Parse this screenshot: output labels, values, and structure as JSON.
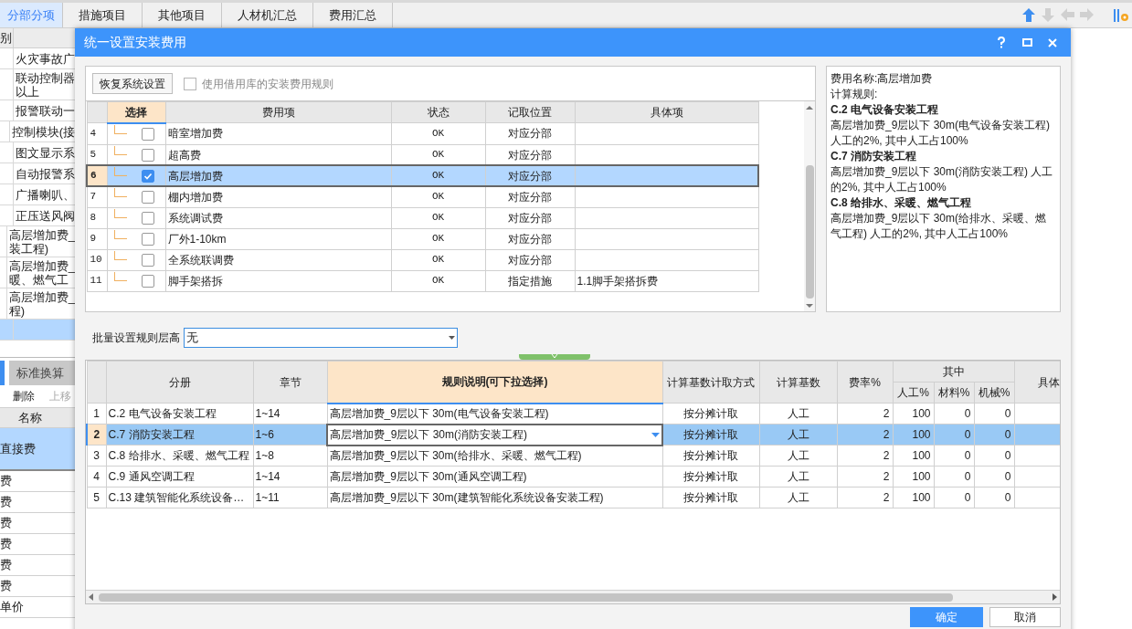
{
  "app_tabs": [
    {
      "label": "分部分项",
      "selected": true
    },
    {
      "label": "措施项目",
      "selected": false
    },
    {
      "label": "其他项目",
      "selected": false
    },
    {
      "label": "人材机汇总",
      "selected": false
    },
    {
      "label": "费用汇总",
      "selected": false
    }
  ],
  "nav_buttons": [
    {
      "kind": "up",
      "disabled": false
    },
    {
      "kind": "down",
      "disabled": true
    },
    {
      "kind": "left",
      "disabled": true
    },
    {
      "kind": "right",
      "disabled": true
    }
  ],
  "background_list": {
    "header": "别",
    "rows": [
      {
        "lines": [
          "火灾事故广"
        ],
        "selected": false
      },
      {
        "lines": [
          "联动控制器",
          "以上"
        ],
        "selected": false
      },
      {
        "lines": [
          "报警联动一"
        ],
        "selected": false
      },
      {
        "lines": [
          "控制模块(接"
        ],
        "selected": false
      },
      {
        "lines": [
          "图文显示系"
        ],
        "selected": false
      },
      {
        "lines": [
          "自动报警系"
        ],
        "selected": false
      },
      {
        "lines": [
          "广播喇叭、"
        ],
        "selected": false
      },
      {
        "lines": [
          "正压送风阀"
        ],
        "selected": false
      },
      {
        "lines": [
          "高层增加费_",
          "装工程)"
        ],
        "selected": false
      },
      {
        "lines": [
          "高层增加费_",
          "暖、燃气工"
        ],
        "selected": false
      },
      {
        "lines": [
          "高层增加费_",
          "程)"
        ],
        "selected": false
      },
      {
        "selected": true
      }
    ]
  },
  "lower_panel": {
    "tab": "标准换算",
    "actions": [
      {
        "label": "删除",
        "disabled": false
      },
      {
        "label": "上移",
        "disabled": true
      }
    ],
    "column": "名称",
    "rows": [
      {
        "text": "直接费",
        "selected": true
      },
      {
        "text": "费",
        "selected": false
      },
      {
        "text": "费",
        "selected": false
      },
      {
        "text": "费",
        "selected": false
      },
      {
        "text": "费",
        "selected": false
      },
      {
        "text": "费",
        "selected": false
      },
      {
        "text": "费",
        "selected": false
      },
      {
        "text": "单价",
        "selected": false
      }
    ]
  },
  "dialog": {
    "title": "统一设置安装费用",
    "restore_button": "恢复系统设置",
    "use_library": {
      "label": "使用借用库的安装费用规则",
      "checked": false
    },
    "fee_table": {
      "columns": [
        "选择",
        "费用项",
        "状态",
        "记取位置",
        "具体项"
      ],
      "rows": [
        {
          "no": "4",
          "checked": false,
          "name": "暗室增加费",
          "status": "OK",
          "position": "对应分部",
          "selected": false
        },
        {
          "no": "5",
          "checked": false,
          "name": "超高费",
          "status": "OK",
          "position": "对应分部",
          "selected": false
        },
        {
          "no": "6",
          "checked": true,
          "name": "高层增加费",
          "status": "OK",
          "position": "对应分部",
          "selected": true
        },
        {
          "no": "7",
          "checked": false,
          "name": "棚内增加费",
          "status": "OK",
          "position": "对应分部",
          "selected": false
        },
        {
          "no": "8",
          "checked": false,
          "name": "系统调试费",
          "status": "OK",
          "position": "对应分部",
          "selected": false
        },
        {
          "no": "9",
          "checked": false,
          "name": "厂外1-10km",
          "status": "OK",
          "position": "对应分部",
          "selected": false
        },
        {
          "no": "10",
          "checked": false,
          "name": "全系统联调费",
          "status": "OK",
          "position": "对应分部",
          "selected": false
        },
        {
          "no": "11",
          "checked": false,
          "name": "脚手架搭拆",
          "status": "OK",
          "position": "指定措施",
          "detail": "1.1脚手架搭拆费",
          "selected": false
        }
      ]
    },
    "info": [
      {
        "kind": "text",
        "text": "费用名称:高层增加费"
      },
      {
        "kind": "text",
        "text": "计算规则:"
      },
      {
        "kind": "heading",
        "text": "C.2 电气设备安装工程"
      },
      {
        "kind": "text",
        "text": "高层增加费_9层以下 30m(电气设备安装工程) 人工的2%, 其中人工占100%"
      },
      {
        "kind": "heading",
        "text": "C.7 消防安装工程"
      },
      {
        "kind": "text",
        "text": "高层增加费_9层以下 30m(消防安装工程) 人工的2%, 其中人工占100%"
      },
      {
        "kind": "heading",
        "text": "C.8 给排水、采暖、燃气工程"
      },
      {
        "kind": "text",
        "text": "高层增加费_9层以下 30m(给排水、采暖、燃气工程) 人工的2%, 其中人工占100%"
      }
    ],
    "batch": {
      "label": "批量设置规则层高",
      "value": "无"
    },
    "rule_table": {
      "columns": {
        "volume": "分册",
        "chapter": "章节",
        "rule": "规则说明(可下拉选择)",
        "method": "计算基数计取方式",
        "base": "计算基数",
        "rate": "费率%",
        "group": "其中",
        "labor": "人工%",
        "material": "材料%",
        "machine": "机械%",
        "detail": "具体"
      },
      "rows": [
        {
          "no": "1",
          "volume": "C.2 电气设备安装工程",
          "chapter": "1~14",
          "rule": "高层增加费_9层以下 30m(电气设备安装工程)",
          "method": "按分摊计取",
          "base": "人工",
          "rate": "2",
          "labor": "100",
          "material": "0",
          "machine": "0",
          "selected": false
        },
        {
          "no": "2",
          "volume": "C.7 消防安装工程",
          "chapter": "1~6",
          "rule": "高层增加费_9层以下 30m(消防安装工程)",
          "method": "按分摊计取",
          "base": "人工",
          "rate": "2",
          "labor": "100",
          "material": "0",
          "machine": "0",
          "selected": true
        },
        {
          "no": "3",
          "volume": "C.8 给排水、采暖、燃气工程",
          "chapter": "1~8",
          "rule": "高层增加费_9层以下 30m(给排水、采暖、燃气工程)",
          "method": "按分摊计取",
          "base": "人工",
          "rate": "2",
          "labor": "100",
          "material": "0",
          "machine": "0",
          "selected": false
        },
        {
          "no": "4",
          "volume": "C.9 通风空调工程",
          "chapter": "1~14",
          "rule": "高层增加费_9层以下 30m(通风空调工程)",
          "method": "按分摊计取",
          "base": "人工",
          "rate": "2",
          "labor": "100",
          "material": "0",
          "machine": "0",
          "selected": false
        },
        {
          "no": "5",
          "volume": "C.13 建筑智能化系统设备…",
          "chapter": "1~11",
          "rule": "高层增加费_9层以下 30m(建筑智能化系统设备安装工程)",
          "method": "按分摊计取",
          "base": "人工",
          "rate": "2",
          "labor": "100",
          "material": "0",
          "machine": "0",
          "selected": false
        }
      ]
    },
    "buttons": [
      {
        "label": "确定",
        "kind": "primary"
      },
      {
        "label": "取消",
        "kind": "secondary"
      }
    ]
  }
}
